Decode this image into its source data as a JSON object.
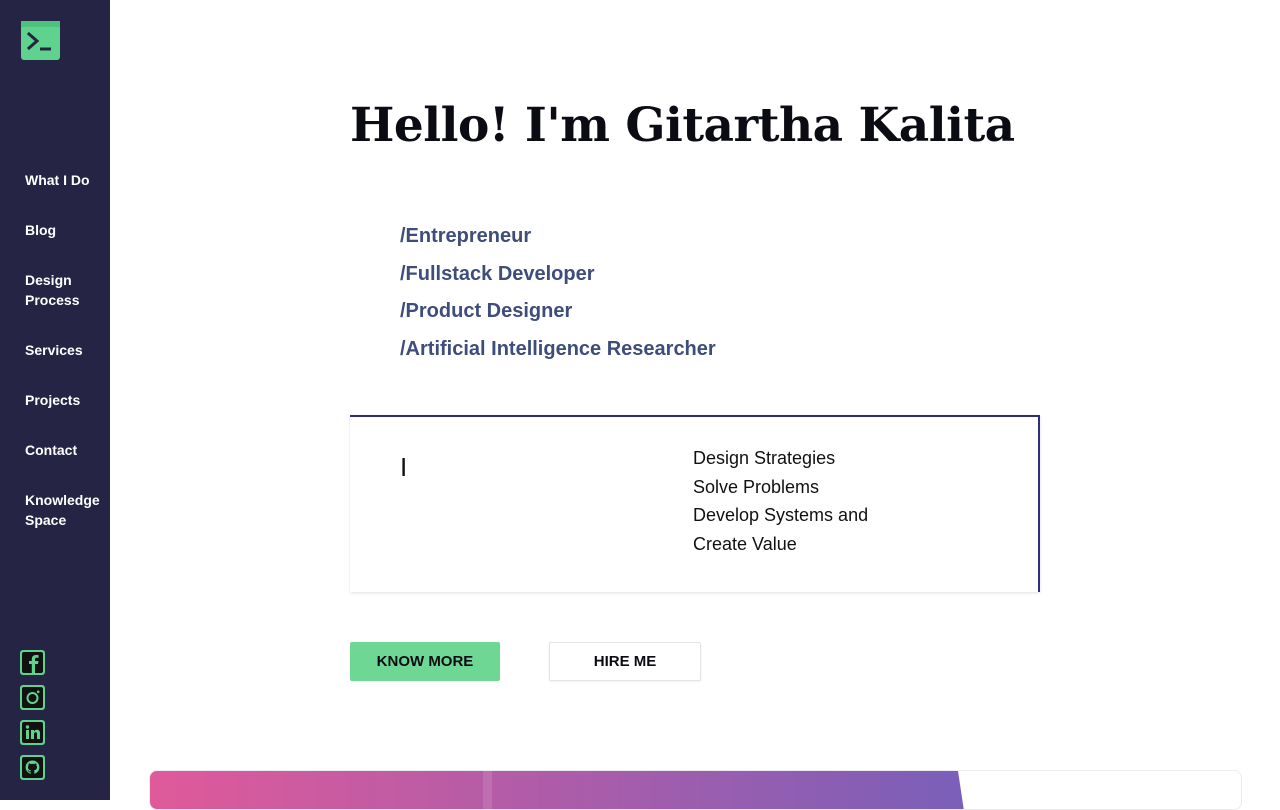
{
  "sidebar": {
    "logo_icon": "terminal-icon",
    "nav": [
      {
        "label": "What I Do"
      },
      {
        "label": "Blog"
      },
      {
        "label": "Design Process"
      },
      {
        "label": "Services"
      },
      {
        "label": "Projects"
      },
      {
        "label": "Contact"
      },
      {
        "label": "Knowledge Space"
      }
    ],
    "social": [
      {
        "icon": "facebook-icon"
      },
      {
        "icon": "instagram-icon"
      },
      {
        "icon": "linkedin-icon"
      },
      {
        "icon": "github-icon"
      }
    ]
  },
  "hero": {
    "title": "Hello! I'm Gitartha Kalita",
    "roles": [
      "/Entrepreneur",
      "/Fullstack Developer",
      "/Product Designer",
      "/Artificial Intelligence Researcher"
    ]
  },
  "card": {
    "prefix": "I",
    "items": [
      "Design Strategies",
      "Solve Problems",
      "Develop Systems and",
      "Create Value"
    ]
  },
  "buttons": {
    "know_more": "KNOW MORE",
    "hire_me": "HIRE ME"
  },
  "colors": {
    "sidebar_bg": "#252444",
    "accent_green": "#5fd38e",
    "role_text": "#3e4d7a",
    "card_border": "#2e2f7a",
    "banner_gradient_start": "#e05a9a",
    "banner_gradient_end": "#7a5fb8"
  }
}
